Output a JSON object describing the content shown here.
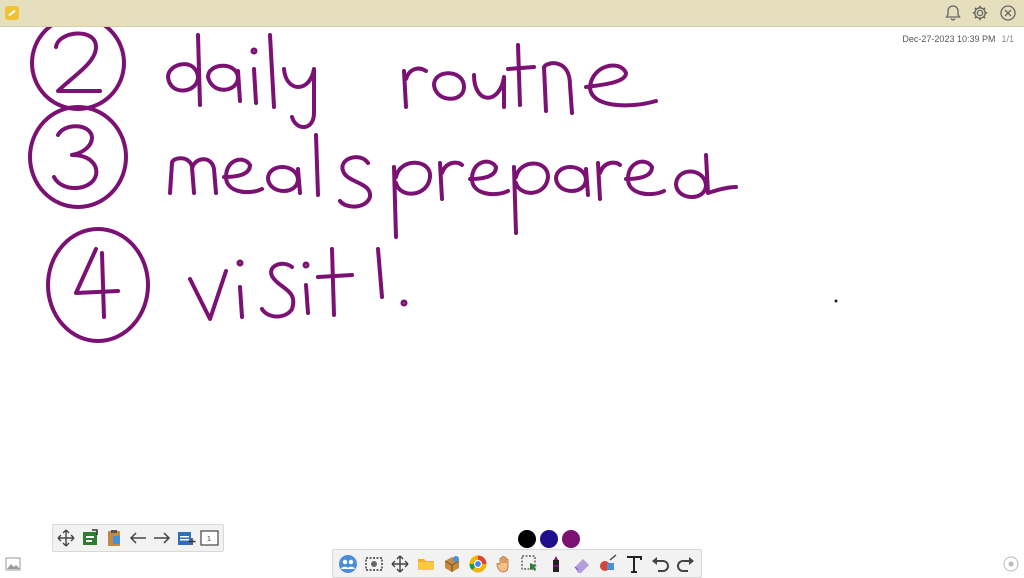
{
  "header": {
    "timestamp": "Dec-27-2023 10:39 PM",
    "page_indicator": "1/1"
  },
  "whiteboard": {
    "ink_color": "#7b1173",
    "item_2_number": "2",
    "item_2_text": "daily routine",
    "item_3_number": "3",
    "item_3_text": "meals prepared",
    "item_4_number": "4",
    "item_4_text": "visit!"
  },
  "page_toolbar": {
    "page_number": "1",
    "icons": [
      "move-icon",
      "export-icon",
      "clipboard-icon",
      "back-arrow-icon",
      "forward-arrow-icon",
      "add-page-icon",
      "page-icon"
    ]
  },
  "pen_colors": [
    "#000000",
    "#1f0f8c",
    "#7b1173"
  ],
  "main_toolbar": {
    "icons": [
      "participants-icon",
      "screenshot-icon",
      "pan-icon",
      "folder-icon",
      "box-icon",
      "browser-icon",
      "hand-icon",
      "select-icon",
      "marker-icon",
      "eraser-icon",
      "shapes-icon",
      "text-icon",
      "undo-icon",
      "redo-icon"
    ]
  }
}
